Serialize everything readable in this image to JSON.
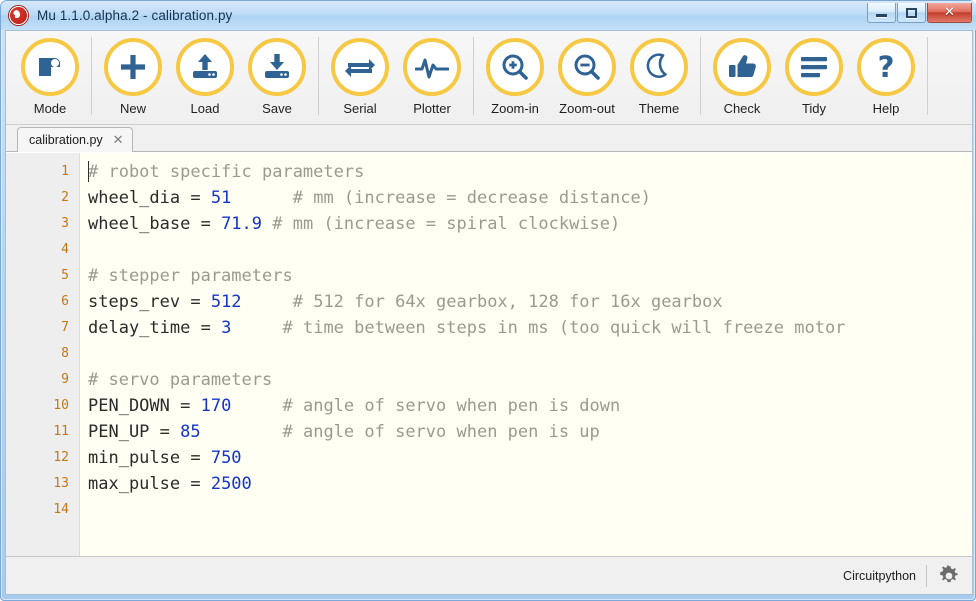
{
  "window": {
    "title": "Mu 1.1.0.alpha.2 - calibration.py",
    "logo_icon": "mu-logo-icon",
    "controls": [
      {
        "name": "minimize",
        "label": "Minimize",
        "icon": "minimize-icon"
      },
      {
        "name": "maximize",
        "label": "Maximize",
        "icon": "maximize-icon"
      },
      {
        "name": "close",
        "label": "Close",
        "icon": "close-icon",
        "glyph": "✕"
      }
    ]
  },
  "colors": {
    "accent_ring": "#f7c843",
    "icon_blue": "#2f6394",
    "line_number": "#c07818",
    "comment": "#9a9a8e",
    "number_literal": "#1433c8",
    "editor_bg": "#fffff4",
    "titlebar_blue": "#aed3f2"
  },
  "toolbar": {
    "items": [
      {
        "label": "Mode",
        "icon": "mode-icon"
      },
      {
        "label": "New",
        "icon": "plus-icon"
      },
      {
        "label": "Load",
        "icon": "upload-icon"
      },
      {
        "label": "Save",
        "icon": "download-icon"
      },
      {
        "label": "Serial",
        "icon": "arrows-exchange-icon"
      },
      {
        "label": "Plotter",
        "icon": "waveform-icon"
      },
      {
        "label": "Zoom-in",
        "icon": "magnifier-plus-icon"
      },
      {
        "label": "Zoom-out",
        "icon": "magnifier-minus-icon"
      },
      {
        "label": "Theme",
        "icon": "moon-icon"
      },
      {
        "label": "Check",
        "icon": "thumbs-up-icon"
      },
      {
        "label": "Tidy",
        "icon": "hamburger-lines-icon"
      },
      {
        "label": "Help",
        "icon": "question-mark-icon"
      }
    ],
    "separators_after": [
      0,
      3,
      5,
      8,
      11
    ]
  },
  "tabs": [
    {
      "label": "calibration.py",
      "close_glyph": "✕",
      "active": true
    }
  ],
  "editor": {
    "line_numbers": [
      "1",
      "2",
      "3",
      "4",
      "5",
      "6",
      "7",
      "8",
      "9",
      "10",
      "11",
      "12",
      "13",
      "14"
    ],
    "lines": [
      [
        {
          "t": "# robot specific parameters",
          "c": "comment"
        }
      ],
      [
        {
          "t": "wheel_dia = ",
          "c": "plain"
        },
        {
          "t": "51",
          "c": "num"
        },
        {
          "t": "      ",
          "c": "plain"
        },
        {
          "t": "# mm (increase = decrease distance)",
          "c": "comment"
        }
      ],
      [
        {
          "t": "wheel_base = ",
          "c": "plain"
        },
        {
          "t": "71.9",
          "c": "num"
        },
        {
          "t": " ",
          "c": "plain"
        },
        {
          "t": "# mm (increase = spiral clockwise)",
          "c": "comment"
        }
      ],
      [
        {
          "t": "",
          "c": "plain"
        }
      ],
      [
        {
          "t": "# stepper parameters",
          "c": "comment"
        }
      ],
      [
        {
          "t": "steps_rev = ",
          "c": "plain"
        },
        {
          "t": "512",
          "c": "num"
        },
        {
          "t": "     ",
          "c": "plain"
        },
        {
          "t": "# 512 for 64x gearbox, 128 for 16x gearbox",
          "c": "comment"
        }
      ],
      [
        {
          "t": "delay_time = ",
          "c": "plain"
        },
        {
          "t": "3",
          "c": "num"
        },
        {
          "t": "     ",
          "c": "plain"
        },
        {
          "t": "# time between steps in ms (too quick will freeze motor",
          "c": "comment"
        }
      ],
      [
        {
          "t": "",
          "c": "plain"
        }
      ],
      [
        {
          "t": "# servo parameters",
          "c": "comment"
        }
      ],
      [
        {
          "t": "PEN_DOWN = ",
          "c": "plain"
        },
        {
          "t": "170",
          "c": "num"
        },
        {
          "t": "     ",
          "c": "plain"
        },
        {
          "t": "# angle of servo when pen is down",
          "c": "comment"
        }
      ],
      [
        {
          "t": "PEN_UP = ",
          "c": "plain"
        },
        {
          "t": "85",
          "c": "num"
        },
        {
          "t": "        ",
          "c": "plain"
        },
        {
          "t": "# angle of servo when pen is up",
          "c": "comment"
        }
      ],
      [
        {
          "t": "min_pulse = ",
          "c": "plain"
        },
        {
          "t": "750",
          "c": "num"
        }
      ],
      [
        {
          "t": "max_pulse = ",
          "c": "plain"
        },
        {
          "t": "2500",
          "c": "num"
        }
      ],
      [
        {
          "t": "",
          "c": "plain"
        }
      ]
    ]
  },
  "statusbar": {
    "mode_label": "Circuitpython",
    "settings_icon": "gear-icon"
  }
}
